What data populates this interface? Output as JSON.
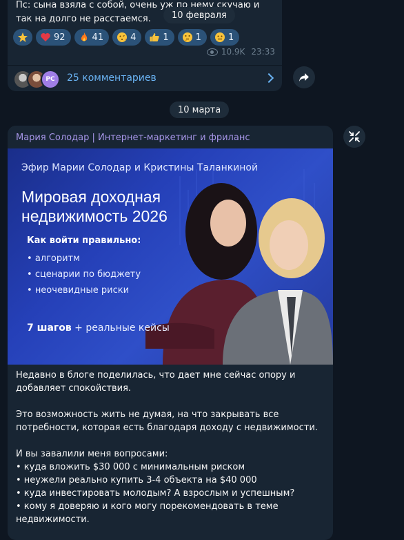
{
  "previous_post": {
    "text_lines": [
      "Пс: сына взяла с собой, очень уж по нему скучаю и",
      "так на долго не расстаемся."
    ],
    "reactions": [
      {
        "icon": "star-icon",
        "count": ""
      },
      {
        "icon": "heart-icon",
        "count": "92"
      },
      {
        "icon": "fire-icon",
        "count": "41"
      },
      {
        "icon": "kiss-face-icon",
        "count": "4"
      },
      {
        "icon": "thumbs-up-icon",
        "count": "1"
      },
      {
        "icon": "thinking-face-icon",
        "count": "1"
      },
      {
        "icon": "neutral-face-icon",
        "count": "1"
      }
    ],
    "views": "10.9K",
    "time": "23:33",
    "comments_label": "25 комментариев",
    "avatar_initials": "РС"
  },
  "floating_date": "10 февраля",
  "date_separator": "10 марта",
  "post": {
    "channel": "Мария Солодар | Интернет-маркетинг и фриланс",
    "banner": {
      "host_line": "Эфир Марии Солодар и Кристины Таланкиной",
      "title_line1": "Мировая доходная",
      "title_line2": "недвижимость 2026",
      "subtitle": "Как войти правильно:",
      "list": [
        "алгоритм",
        "сценарии по бюджету",
        "неочевидные риски"
      ],
      "steps_bold": "7 шагов",
      "steps_rest": " + реальные кейсы"
    },
    "paragraphs": [
      [
        "Недавно в блоге поделилась, что дает мне сейчас опору и",
        "добавляет спокойствия."
      ],
      [
        "Это возможность жить не думая, на что закрывать все",
        "потребности, которая есть благодаря доходу с недвижимости."
      ],
      [
        "И вы завалили меня вопросами:",
        "• куда вложить $30 000 с минимальным риском",
        "• неужели реально купить 3-4 объекта на $40 000",
        "• куда инвестировать молодым? А взрослым и успешным?",
        "• кому я доверяю и кого могу порекомендовать в теме",
        "недвижимости."
      ]
    ]
  },
  "colors": {
    "background": "#0e1621",
    "bubble": "#182533",
    "accent_link": "#6ab3f3",
    "channel_name": "#a695e7",
    "reaction_bg": "#2b5278"
  }
}
